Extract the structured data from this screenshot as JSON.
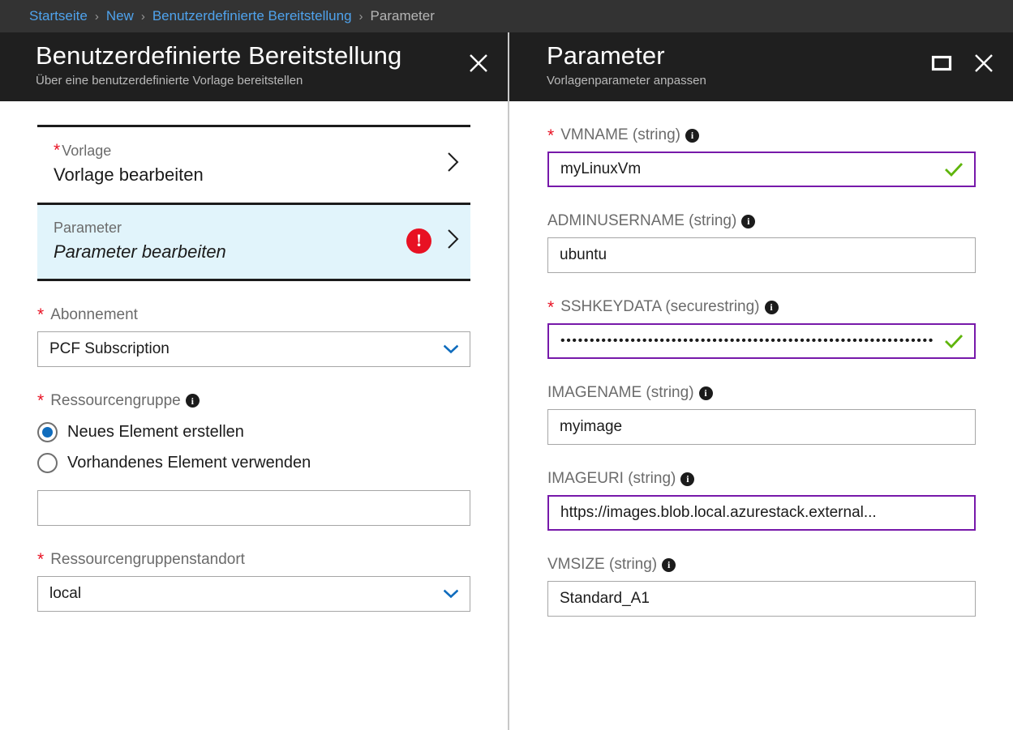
{
  "breadcrumb": {
    "items": [
      {
        "label": "Startseite",
        "current": false
      },
      {
        "label": "New",
        "current": false
      },
      {
        "label": "Benutzerdefinierte Bereitstellung",
        "current": false
      },
      {
        "label": "Parameter",
        "current": true
      }
    ],
    "separator": "›"
  },
  "colors": {
    "breadcrumb_bg": "#333333",
    "header_bg": "#1f1f1f",
    "link": "#4fa3ed",
    "accent_blue": "#0f6cbd",
    "error_red": "#e81123",
    "focus_purple": "#7719aa",
    "valid_green": "#5fb50c",
    "selected_row_bg": "#e1f4fb"
  },
  "left_blade": {
    "title": "Benutzerdefinierte Bereitstellung",
    "subtitle": "Über eine benutzerdefinierte Vorlage bereitstellen",
    "close_icon": "close-icon",
    "steps": [
      {
        "label": "Vorlage",
        "value": "Vorlage bearbeiten",
        "required": true,
        "selected": false,
        "italic": false,
        "has_error": false,
        "chevron_icon": "chevron-right-icon"
      },
      {
        "label": "Parameter",
        "value": "Parameter bearbeiten",
        "required": false,
        "selected": true,
        "italic": true,
        "has_error": true,
        "error_icon": "error-exclamation-icon",
        "error_glyph": "!",
        "chevron_icon": "chevron-right-icon"
      }
    ],
    "subscription": {
      "label": "Abonnement",
      "required": true,
      "value": "PCF Subscription",
      "chevron_icon": "chevron-down-icon"
    },
    "resource_group": {
      "label": "Ressourcengruppe",
      "required": true,
      "info_icon": "info-icon",
      "options": [
        {
          "label": "Neues Element erstellen",
          "checked": true
        },
        {
          "label": "Vorhandenes Element verwenden",
          "checked": false
        }
      ],
      "input_value": "",
      "input_placeholder": ""
    },
    "resource_group_location": {
      "label": "Ressourcengruppenstandort",
      "required": true,
      "value": "local",
      "chevron_icon": "chevron-down-icon"
    }
  },
  "right_blade": {
    "title": "Parameter",
    "subtitle": "Vorlagenparameter anpassen",
    "maximize_icon": "maximize-icon",
    "close_icon": "close-icon",
    "parameters": [
      {
        "label": "VMNAME (string)",
        "required": true,
        "info_icon": "info-icon",
        "value": "myLinuxVm",
        "focused": true,
        "valid": true,
        "secure": false
      },
      {
        "label": "ADMINUSERNAME (string)",
        "required": false,
        "info_icon": "info-icon",
        "value": "ubuntu",
        "focused": false,
        "valid": false,
        "secure": false
      },
      {
        "label": "SSHKEYDATA (securestring)",
        "required": true,
        "info_icon": "info-icon",
        "value": "••••••••••••••••••••••••••••••••••••••••••••••••••••••••••••••••",
        "focused": true,
        "valid": true,
        "secure": true
      },
      {
        "label": "IMAGENAME (string)",
        "required": false,
        "info_icon": "info-icon",
        "value": "myimage",
        "focused": false,
        "valid": false,
        "secure": false
      },
      {
        "label": "IMAGEURI (string)",
        "required": false,
        "info_icon": "info-icon",
        "value": "https://images.blob.local.azurestack.external...",
        "focused": true,
        "valid": false,
        "secure": false
      },
      {
        "label": "VMSIZE (string)",
        "required": false,
        "info_icon": "info-icon",
        "value": "Standard_A1",
        "focused": false,
        "valid": false,
        "secure": false
      }
    ]
  }
}
